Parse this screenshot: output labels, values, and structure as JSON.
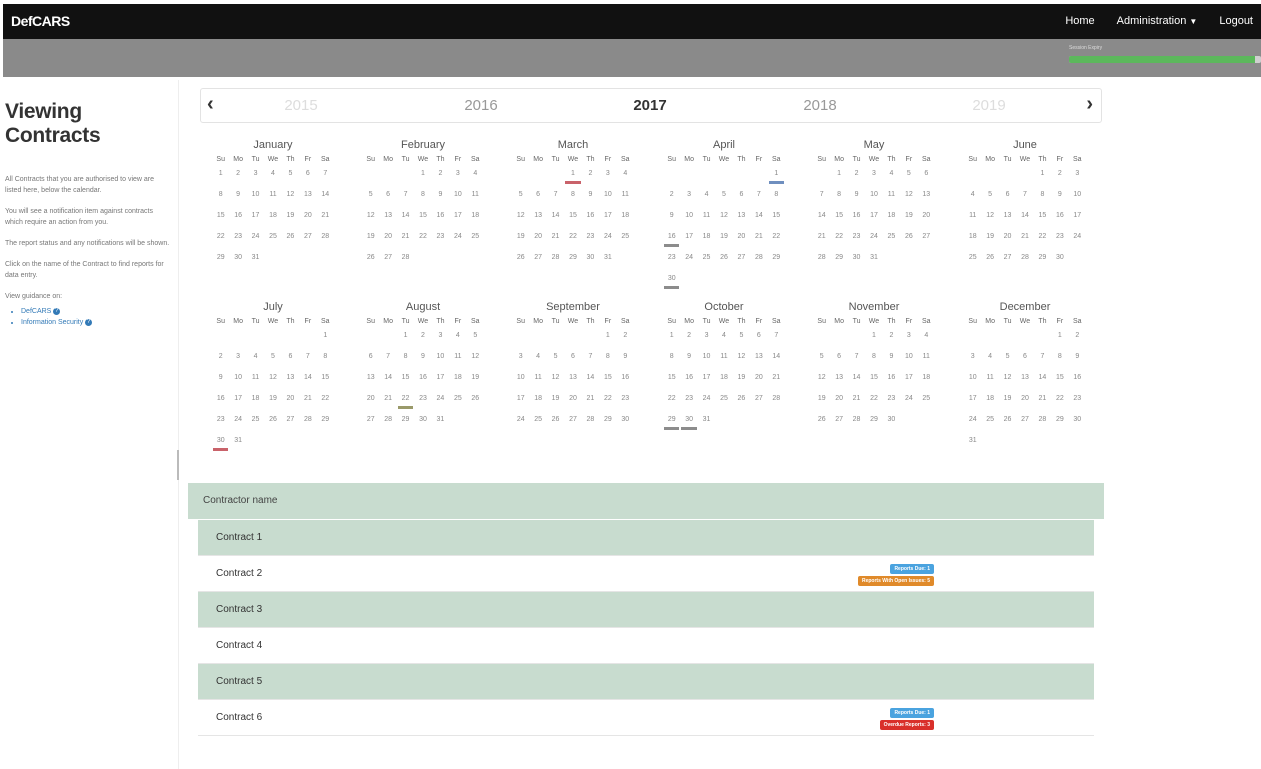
{
  "app": {
    "brand": "DefCARS"
  },
  "nav": {
    "home": "Home",
    "administration": "Administration",
    "logout": "Logout"
  },
  "session": {
    "label": "Session Expiry",
    "progress": 0.97
  },
  "sidebar": {
    "title_line1": "Viewing",
    "title_line2": "Contracts",
    "para1": "All Contracts that you are authorised to view are listed here, below the calendar.",
    "para2": "You will see a notification item against contracts which require an action from you.",
    "para3": "The report status and any notifications will be shown.",
    "para4": "Click on the name of the Contract to find reports for data entry.",
    "guidance_label": "View guidance on:",
    "links": [
      "DefCARS",
      "Information Security"
    ]
  },
  "year_nav": {
    "prev": "‹",
    "next": "›",
    "years": [
      "2015",
      "2016",
      "2017",
      "2018",
      "2019"
    ],
    "selected": "2017"
  },
  "calendar": {
    "weekdays": [
      "Su",
      "Mo",
      "Tu",
      "We",
      "Th",
      "Fr",
      "Sa"
    ],
    "months": [
      {
        "name": "January",
        "start": 0,
        "days": 31
      },
      {
        "name": "February",
        "start": 3,
        "days": 28
      },
      {
        "name": "March",
        "start": 3,
        "days": 31,
        "marks": {
          "1": "red"
        }
      },
      {
        "name": "April",
        "start": 6,
        "days": 30,
        "marks": {
          "1": "blue",
          "16": "gray",
          "30": "gray"
        }
      },
      {
        "name": "May",
        "start": 1,
        "days": 31
      },
      {
        "name": "June",
        "start": 4,
        "days": 30
      },
      {
        "name": "July",
        "start": 6,
        "days": 31,
        "marks": {
          "30": "red"
        }
      },
      {
        "name": "August",
        "start": 2,
        "days": 31,
        "marks": {
          "22": "olive"
        }
      },
      {
        "name": "September",
        "start": 5,
        "days": 30
      },
      {
        "name": "October",
        "start": 0,
        "days": 31,
        "marks": {
          "29": "gray",
          "30": "gray"
        }
      },
      {
        "name": "November",
        "start": 3,
        "days": 30
      },
      {
        "name": "December",
        "start": 5,
        "days": 31
      }
    ]
  },
  "contracts": {
    "header": "Contractor name",
    "rows": [
      {
        "name": "Contract 1",
        "badges": []
      },
      {
        "name": "Contract 2",
        "badges": [
          {
            "text": "Reports Due: 1",
            "color": "blue"
          },
          {
            "text": "Reports With Open Issues: 5",
            "color": "orange"
          }
        ]
      },
      {
        "name": "Contract 3",
        "badges": []
      },
      {
        "name": "Contract 4",
        "badges": []
      },
      {
        "name": "Contract 5",
        "badges": []
      },
      {
        "name": "Contract 6",
        "badges": [
          {
            "text": "Reports Due: 1",
            "color": "blue"
          },
          {
            "text": "Overdue Reports: 3",
            "color": "red"
          }
        ]
      }
    ]
  },
  "colors": {
    "navbar": "#111111",
    "row_alt": "#c8dccf",
    "link": "#337ab7"
  }
}
